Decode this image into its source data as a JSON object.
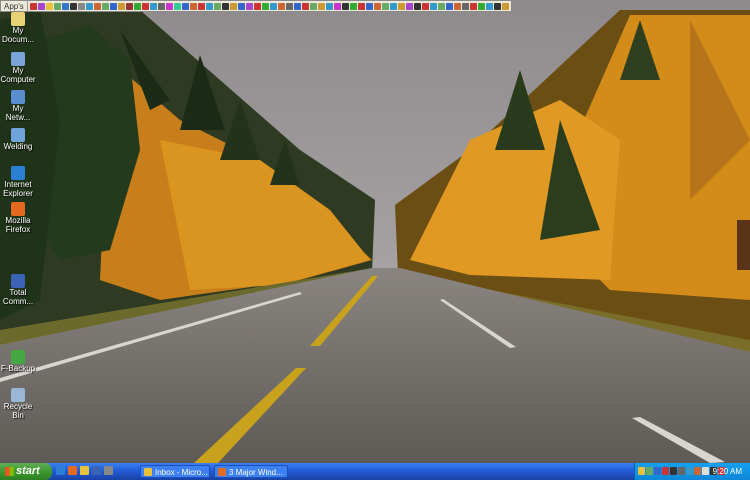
{
  "toolbar": {
    "label": "App's"
  },
  "toolbar_icon_colors": [
    "#c33",
    "#a4c",
    "#e8c23a",
    "#6a6",
    "#37c",
    "#333",
    "#888",
    "#39c",
    "#c63",
    "#6a6",
    "#36c",
    "#c93",
    "#933",
    "#3a3",
    "#c33",
    "#39c",
    "#666",
    "#c3c",
    "#3c9",
    "#36c",
    "#c63",
    "#c33",
    "#39c",
    "#6a6",
    "#333",
    "#c93",
    "#36c",
    "#a4c",
    "#c33",
    "#3a3",
    "#39c",
    "#c63",
    "#666",
    "#36c",
    "#c33",
    "#6a6",
    "#c93",
    "#39c",
    "#c3c",
    "#333",
    "#3a3",
    "#c33",
    "#36c",
    "#c63",
    "#6a6",
    "#39c",
    "#c93",
    "#a4c",
    "#333",
    "#c33",
    "#39c",
    "#6a6",
    "#36c",
    "#c63",
    "#666",
    "#c33",
    "#3a3",
    "#39c",
    "#333",
    "#c93"
  ],
  "desktop_icons": [
    {
      "name": "my-documents-icon",
      "label1": "My",
      "label2": "Docum...",
      "color": "#e8d274"
    },
    {
      "name": "my-computer-icon",
      "label1": "My",
      "label2": "Computer",
      "color": "#7aa4d8"
    },
    {
      "name": "my-network-icon",
      "label1": "My",
      "label2": "Netw...",
      "color": "#5b8ed0"
    },
    {
      "name": "welding-icon",
      "label1": "Welding",
      "label2": "",
      "color": "#6fa3d9"
    },
    {
      "name": "internet-explorer-icon",
      "label1": "Internet",
      "label2": "Explorer",
      "color": "#2b7fd4"
    },
    {
      "name": "mozilla-firefox-icon",
      "label1": "Mozilla",
      "label2": "Firefox",
      "color": "#e46a1f"
    },
    {
      "name": "total-commander-icon",
      "label1": "Total",
      "label2": "Comm...",
      "color": "#3a63b8"
    },
    {
      "name": "f-backup-icon",
      "label1": "F-Backup",
      "label2": "",
      "color": "#44a844"
    },
    {
      "name": "recycle-bin-icon",
      "label1": "Recycle",
      "label2": "Bin",
      "color": "#9ab7d6"
    }
  ],
  "taskbar": {
    "start_label": "start",
    "quicklaunch_colors": [
      "#2b7fd4",
      "#e46a1f",
      "#e8c23a",
      "#3a63b8",
      "#888"
    ],
    "tasks": [
      {
        "label": "Inbox - Micro...",
        "icon_color": "#e8c23a"
      },
      {
        "label": "3 Major Wind...",
        "icon_color": "#e46a1f"
      }
    ],
    "tray_icon_colors": [
      "#e8c23a",
      "#6a6",
      "#36c",
      "#c33",
      "#333",
      "#666",
      "#39c",
      "#c63",
      "#ddd",
      "#333",
      "#c33"
    ],
    "clock": "9:20 AM"
  }
}
